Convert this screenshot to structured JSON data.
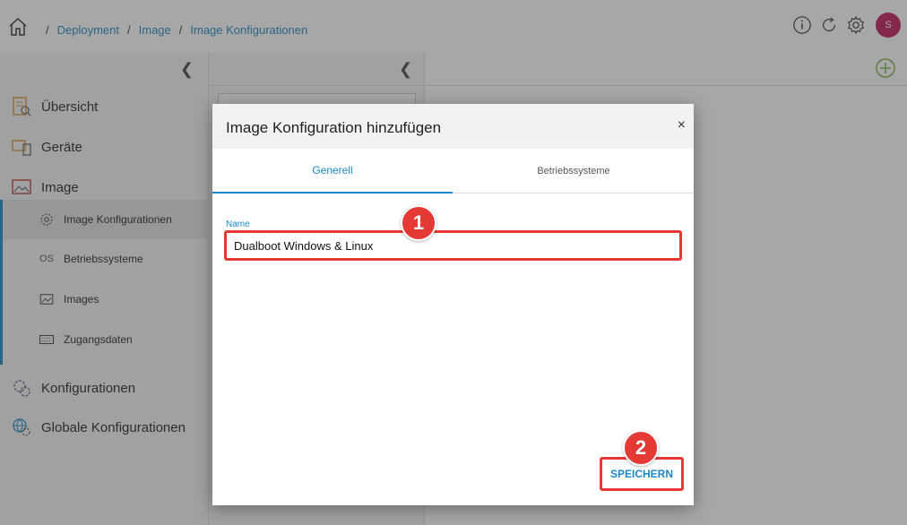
{
  "breadcrumb": {
    "items": [
      "Deployment",
      "Image",
      "Image Konfigurationen"
    ],
    "separator": "/"
  },
  "header": {
    "avatar_initial": "S"
  },
  "sidebar": {
    "items": [
      {
        "label": "Übersicht",
        "icon": "overview-icon"
      },
      {
        "label": "Geräte",
        "icon": "devices-icon"
      },
      {
        "label": "Image",
        "icon": "image-icon"
      }
    ],
    "sub_items": [
      {
        "label": "Image Konfigurationen",
        "icon": "gear-icon",
        "active": true
      },
      {
        "label": "Betriebssysteme",
        "icon": "os-icon",
        "icon_text": "OS"
      },
      {
        "label": "Images",
        "icon": "image-small-icon"
      },
      {
        "label": "Zugangsdaten",
        "icon": "keyboard-icon"
      }
    ],
    "bottom_items": [
      {
        "label": "Konfigurationen",
        "icon": "gears-icon"
      },
      {
        "label": "Globale Konfigurationen",
        "icon": "globe-gear-icon"
      }
    ]
  },
  "dialog": {
    "title": "Image Konfiguration hinzufügen",
    "close_glyph": "×",
    "tabs": [
      "Generell",
      "Betriebssysteme"
    ],
    "field_label": "Name",
    "field_value": "Dualboot Windows & Linux",
    "save_label": "SPEICHERN"
  },
  "annotations": [
    "1",
    "2"
  ],
  "colors": {
    "accent": "#1c88c7",
    "highlight": "#e53935",
    "avatar": "#c2185b"
  }
}
